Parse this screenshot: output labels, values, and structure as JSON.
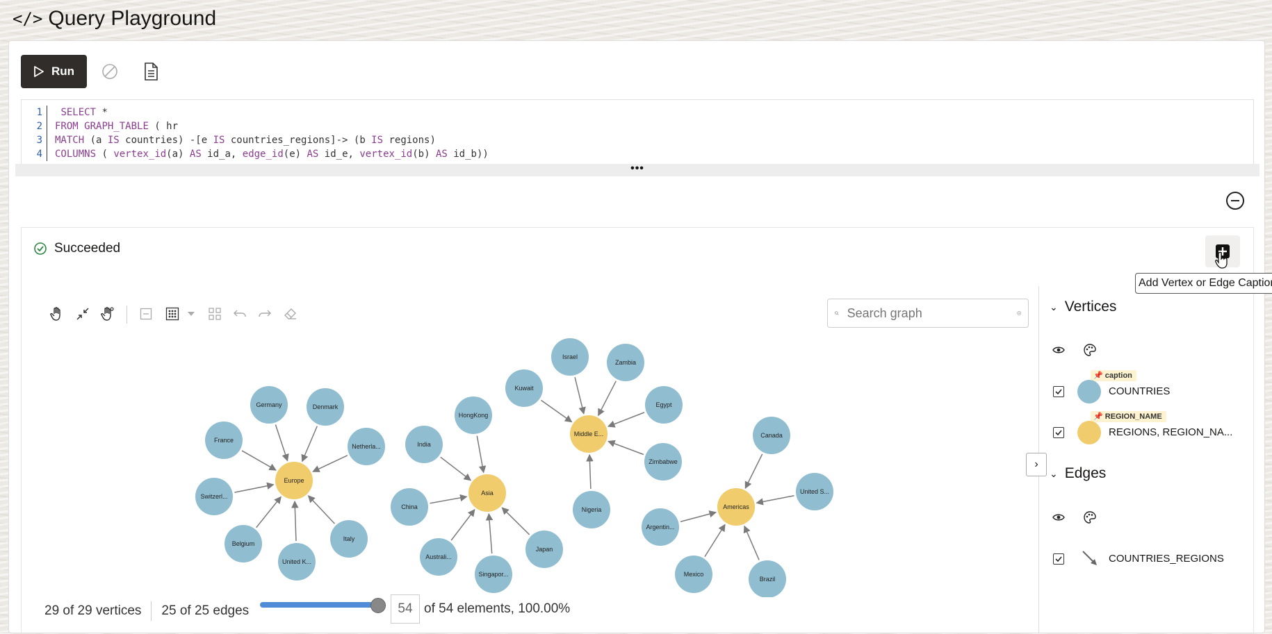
{
  "page": {
    "title": "Query Playground"
  },
  "toolbar": {
    "run_label": "Run"
  },
  "editor": {
    "line_numbers": [
      "1",
      "2",
      "3",
      "4"
    ]
  },
  "status": {
    "text": "Succeeded"
  },
  "tooltip": {
    "text": "Add Vertex or Edge Captions"
  },
  "search": {
    "placeholder": "Search graph"
  },
  "graph": {
    "hubs": [
      "Europe",
      "Asia",
      "Middle E...",
      "Americas"
    ],
    "countries": {
      "Europe": [
        "Germany",
        "Denmark",
        "France",
        "Netherla...",
        "Switzerl...",
        "Belgium",
        "United K...",
        "Italy"
      ],
      "Asia": [
        "HongKong",
        "India",
        "China",
        "Australi...",
        "Singapor...",
        "Japan"
      ],
      "Middle E...": [
        "Israel",
        "Zambia",
        "Kuwait",
        "Egypt",
        "Zimbabwe",
        "Nigeria"
      ],
      "Americas": [
        "Canada",
        "United S...",
        "Argentin...",
        "Mexico",
        "Brazil"
      ]
    },
    "colors": {
      "vertex_country": "#91bdd1",
      "vertex_region": "#f0cc6c",
      "edge": "#7a7a7a"
    }
  },
  "footer": {
    "vertices": "29 of 29 vertices",
    "edges": "25 of 25 edges",
    "elements_value": "54",
    "elements_suffix": "of 54 elements, 100.00%",
    "slider_fraction": 1.0
  },
  "legend": {
    "vertices_title": "Vertices",
    "edges_title": "Edges",
    "vertex_items": [
      {
        "tag": "caption",
        "label": "COUNTRIES",
        "color": "#91bdd1"
      },
      {
        "tag": "REGION_NAME",
        "label": "REGIONS, REGION_NA...",
        "color": "#f0cc6c"
      }
    ],
    "edge_items": [
      {
        "label": "COUNTRIES_REGIONS"
      }
    ]
  }
}
